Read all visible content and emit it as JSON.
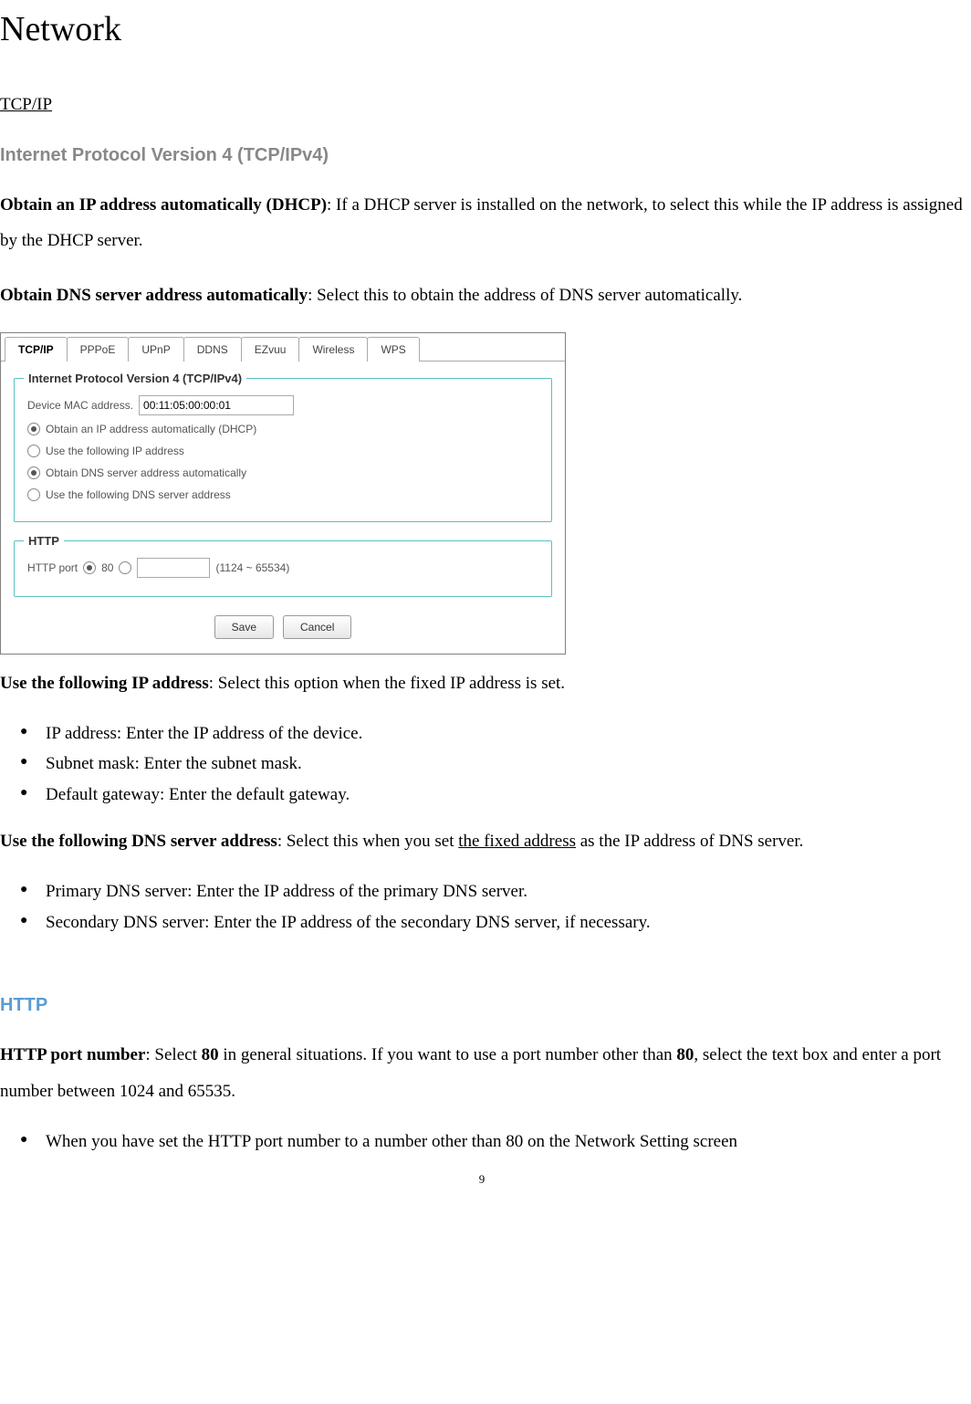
{
  "page": {
    "title": "Network",
    "tcpip_link": "TCP/IP",
    "ipv4_heading": "Internet Protocol Version 4 (TCP/IPv4)",
    "http_heading": "HTTP",
    "page_number": "9"
  },
  "paragraphs": {
    "dhcp_label": "Obtain an IP address automatically (DHCP)",
    "dhcp_text": ": If a DHCP server is installed on the network, to select this while the IP address is assigned by the DHCP server.",
    "dns_auto_label": "Obtain DNS server address automatically",
    "dns_auto_text": ": Select this to obtain the address of DNS server automatically.",
    "use_ip_label": "Use the following IP address",
    "use_ip_text": ": Select this option when the fixed IP address is set.",
    "use_dns_label": "Use the following DNS server address",
    "use_dns_text_a": ": Select this when you set ",
    "use_dns_text_u": "the fixed address",
    "use_dns_text_b": " as the IP address of DNS server.",
    "http_port_label": "HTTP port number",
    "http_port_text_a": ": Select ",
    "http_port_bold1": "80",
    "http_port_text_b": " in general situations. If you want to use a port number other than ",
    "http_port_bold2": "80",
    "http_port_text_c": ", select the text box and enter a port number between 1024 and 65535."
  },
  "bullets_ip": {
    "0": "IP address: Enter the IP address of the device.",
    "1": "Subnet mask: Enter the subnet mask.",
    "2": "Default gateway: Enter the default gateway."
  },
  "bullets_dns": {
    "0": "Primary DNS server: Enter the IP address of the primary DNS server.",
    "1": "Secondary DNS server: Enter the IP address of the secondary DNS server, if necessary."
  },
  "bullets_http": {
    "0": "When you have set the HTTP port number to a number other than 80 on the Network Setting screen"
  },
  "figure": {
    "tabs": {
      "0": "TCP/IP",
      "1": "PPPoE",
      "2": "UPnP",
      "3": "DDNS",
      "4": "EZvuu",
      "5": "Wireless",
      "6": "WPS"
    },
    "ipv4_legend": "Internet Protocol Version 4 (TCP/IPv4)",
    "mac_label": "Device MAC address.",
    "mac_value": "00:11:05:00:00:01",
    "radio_dhcp": "Obtain an IP address automatically (DHCP)",
    "radio_useip": "Use the following IP address",
    "radio_dnsauto": "Obtain DNS server address automatically",
    "radio_usedns": "Use the following DNS server address",
    "http_legend": "HTTP",
    "http_port_label": "HTTP port",
    "http_port_80": "80",
    "http_port_range": "(1124 ~ 65534)",
    "save": "Save",
    "cancel": "Cancel"
  }
}
